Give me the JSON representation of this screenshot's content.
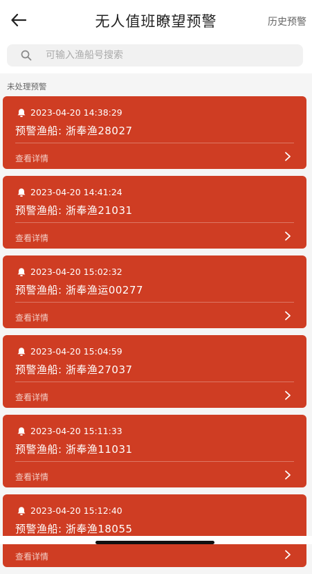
{
  "header": {
    "back_icon": "arrow-left-icon",
    "title": "无人值班瞭望预警",
    "history_label": "历史预警"
  },
  "search": {
    "icon": "search-icon",
    "placeholder": "可输入渔船号搜索",
    "value": ""
  },
  "section_label": "未处理预警",
  "colors": {
    "card_bg": "#cf3d23",
    "page_bg": "#f5f5f5"
  },
  "alerts": [
    {
      "time": "2023-04-20 14:38:29",
      "vessel": "预警渔船: 浙奉渔28027",
      "detail_label": "查看详情"
    },
    {
      "time": "2023-04-20 14:41:24",
      "vessel": "预警渔船: 浙奉渔21031",
      "detail_label": "查看详情"
    },
    {
      "time": "2023-04-20 15:02:32",
      "vessel": "预警渔船: 浙奉渔运00277",
      "detail_label": "查看详情"
    },
    {
      "time": "2023-04-20 15:04:59",
      "vessel": "预警渔船: 浙奉渔27037",
      "detail_label": "查看详情"
    },
    {
      "time": "2023-04-20 15:11:33",
      "vessel": "预警渔船: 浙奉渔11031",
      "detail_label": "查看详情"
    },
    {
      "time": "2023-04-20 15:12:40",
      "vessel": "预警渔船: 浙奉渔18055",
      "detail_label": "查看详情"
    }
  ]
}
